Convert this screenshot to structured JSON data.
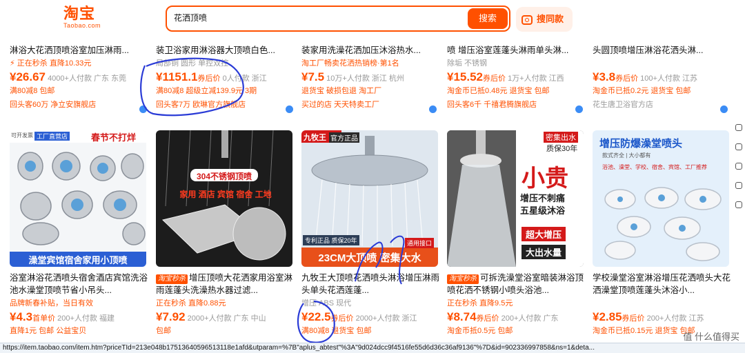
{
  "header": {
    "logo_text": "淘宝",
    "logo_sub": "Taobao.com",
    "search_value": "花洒顶喷",
    "search_button": "搜索",
    "photo_search": "搜同款"
  },
  "top_row": [
    {
      "title": "淋浴大花洒顶喷浴室加压淋雨...",
      "promo": "⚡ 正在秒杀 直降10.33元",
      "price": "¥26.67",
      "sales": "4000+人付款 广东 东莞",
      "tags": "满80减8  包邮",
      "store": "回头客60万 净立安旗舰店"
    },
    {
      "title": "装卫浴家用淋浴器大顶喷白色...",
      "attrs": "局部铜 圆形 单控双控",
      "price": "¥1151.1",
      "price_suffix": "券后价",
      "sales": "0人付款 浙江",
      "tags": "满80减8  超级立减139.9元  3期",
      "store": "回头客7万 欧琳官方旗舰店"
    },
    {
      "title": "装家用洗澡花洒加压沐浴热水...",
      "attrs": "淘工厂畅卖花洒热销榜·第1名",
      "price": "¥7.5",
      "sales": "10万+人付款 浙江 杭州",
      "tags": "退货宝  破损包退  淘工厂",
      "store": "买过的店 天天特卖工厂"
    },
    {
      "title": "喷 增压浴室莲蓬头淋雨单头淋...",
      "attrs": "除垢  不锈钢",
      "price": "¥15.52",
      "price_suffix": "券后价",
      "sales": "1万+人付款 江西",
      "tags": "淘金币已抵0.48元  退货宝  包邮",
      "store": "回头客6千 千禧君腾旗舰店"
    },
    {
      "title": "头圆顶喷增压淋浴花洒头淋...",
      "price": "¥3.8",
      "price_suffix": "券后价",
      "sales": "100+人付款 江苏",
      "tags": "淘金币已抵0.2元  退货宝  包邮",
      "store": "花生唐卫浴官方店"
    }
  ],
  "bottom_row": [
    {
      "img_banner_left": "可开发票",
      "img_badge": "工厂直营店",
      "img_banner_right": "春节不打烊",
      "img_caption": "澡堂宾馆宿舍家用小顶喷",
      "title": "浴室淋浴花洒喷头宿舍酒店宾馆洗浴池水澡堂顶喷节省小吊头...",
      "promo": "品牌新春补贴，当日有效",
      "price": "¥4.3",
      "price_suffix": "首单价",
      "sales": "200+人付款 福建",
      "tags": "直降1元  包邮  公益宝贝"
    },
    {
      "img_line1": "304不锈钢顶喷",
      "img_line2": "家用 酒店 宾馆 宿舍 工地",
      "seckill": "淘宝秒杀",
      "title": "增压顶喷大花洒家用浴室淋雨莲蓬头洗澡热水器过滤...",
      "promo": "正在秒杀 直降0.88元",
      "price": "¥7.92",
      "sales": "2000+人付款 广东 中山",
      "tags": "包邮"
    },
    {
      "img_brand": "九牧王",
      "img_flag": "官方正品",
      "img_note1": "专利正品 质保20年",
      "img_note2": "通用接口",
      "img_caption": "23CM大顶喷 密集大水",
      "title": "九牧王大顶喷花洒喷头淋浴增压淋雨头单头花洒莲蓬...",
      "attrs": "增压  ABS  现代",
      "price": "¥22.5",
      "price_suffix": "券后价",
      "sales": "2000+人付款 浙江",
      "tags": "满80减8  退货宝  包邮"
    },
    {
      "img_tag": "密集出水",
      "img_sub": "质保30年",
      "img_big": "小贵",
      "img_l1": "增压不刺痛",
      "img_l2": "五星级沐浴",
      "img_box1": "超大增压",
      "img_box2": "大出水量",
      "seckill": "淘宝秒杀",
      "title": "可拆洗澡堂浴室暗装淋浴顶喷花洒不锈钢小喷头浴池...",
      "promo": "正在秒杀 直降9.5元",
      "price": "¥8.74",
      "price_suffix": "券后价",
      "sales": "200+人付款 广东",
      "tags": "淘金币抵0.5元  包邮"
    },
    {
      "img_title": "增压防爆澡堂喷头",
      "img_sub": "款式齐全 | 大小都有",
      "img_uses": "浴池、澡堂、学校、宿舍、宾馆、工厂推荐",
      "title": "学校澡堂浴室淋浴增压花洒喷头大花洒澡堂顶喷莲蓬头沐浴小...",
      "price": "¥2.85",
      "price_suffix": "券后价",
      "sales": "200+人付款 江苏",
      "tags": "淘金币已抵0.15元  退货宝  包邮"
    }
  ],
  "status_url": "https://item.taobao.com/item.htm?priceTId=213e048b17513640596513118e1afd&utparam=%7B\"aplus_abtest\"%3A\"9d024dcc9f4516fe55d6d36c36af9136\"%7D&id=902336997858&ns=1&deta...",
  "watermark": "值 什么值得买",
  "colors": {
    "accent": "#ff5000",
    "annotation": "#2a3bd6"
  }
}
